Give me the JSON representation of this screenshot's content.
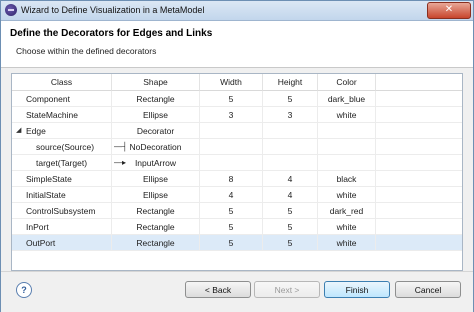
{
  "window": {
    "title": "Wizard to Define Visualization in a MetaModel",
    "close_glyph": "✕"
  },
  "header": {
    "title": "Define the Decorators for Edges and Links",
    "subtitle": "Choose within the defined decorators"
  },
  "table": {
    "columns": [
      "Class",
      "Shape",
      "Width",
      "Height",
      "Color"
    ],
    "rows": [
      {
        "class": "Component",
        "shape": "Rectangle",
        "width": "5",
        "height": "5",
        "color": "dark_blue"
      },
      {
        "class": "StateMachine",
        "shape": "Ellipse",
        "width": "3",
        "height": "3",
        "color": "white"
      },
      {
        "class": "Edge",
        "shape": "Decorator",
        "width": "",
        "height": "",
        "color": "",
        "expander": "◢",
        "expanded": true
      },
      {
        "class": "source(Source)",
        "shape": "NoDecoration",
        "width": "",
        "height": "",
        "color": "",
        "glyph": "—┤",
        "indent": true
      },
      {
        "class": "target(Target)",
        "shape": "InputArrow",
        "width": "",
        "height": "",
        "color": "",
        "glyph": "—▸",
        "indent": true
      },
      {
        "class": "SimpleState",
        "shape": "Ellipse",
        "width": "8",
        "height": "4",
        "color": "black"
      },
      {
        "class": "InitialState",
        "shape": "Ellipse",
        "width": "4",
        "height": "4",
        "color": "white"
      },
      {
        "class": "ControlSubsystem",
        "shape": "Rectangle",
        "width": "5",
        "height": "5",
        "color": "dark_red"
      },
      {
        "class": "InPort",
        "shape": "Rectangle",
        "width": "5",
        "height": "5",
        "color": "white"
      },
      {
        "class": "OutPort",
        "shape": "Rectangle",
        "width": "5",
        "height": "5",
        "color": "white",
        "selected": true
      }
    ]
  },
  "footer": {
    "help_glyph": "?",
    "back_label": "< Back",
    "next_label": "Next >",
    "finish_label": "Finish",
    "cancel_label": "Cancel"
  },
  "colors": {
    "selection": "#dceaf8",
    "titlebar": "#c2d6ec",
    "close_button": "#c8452c"
  }
}
